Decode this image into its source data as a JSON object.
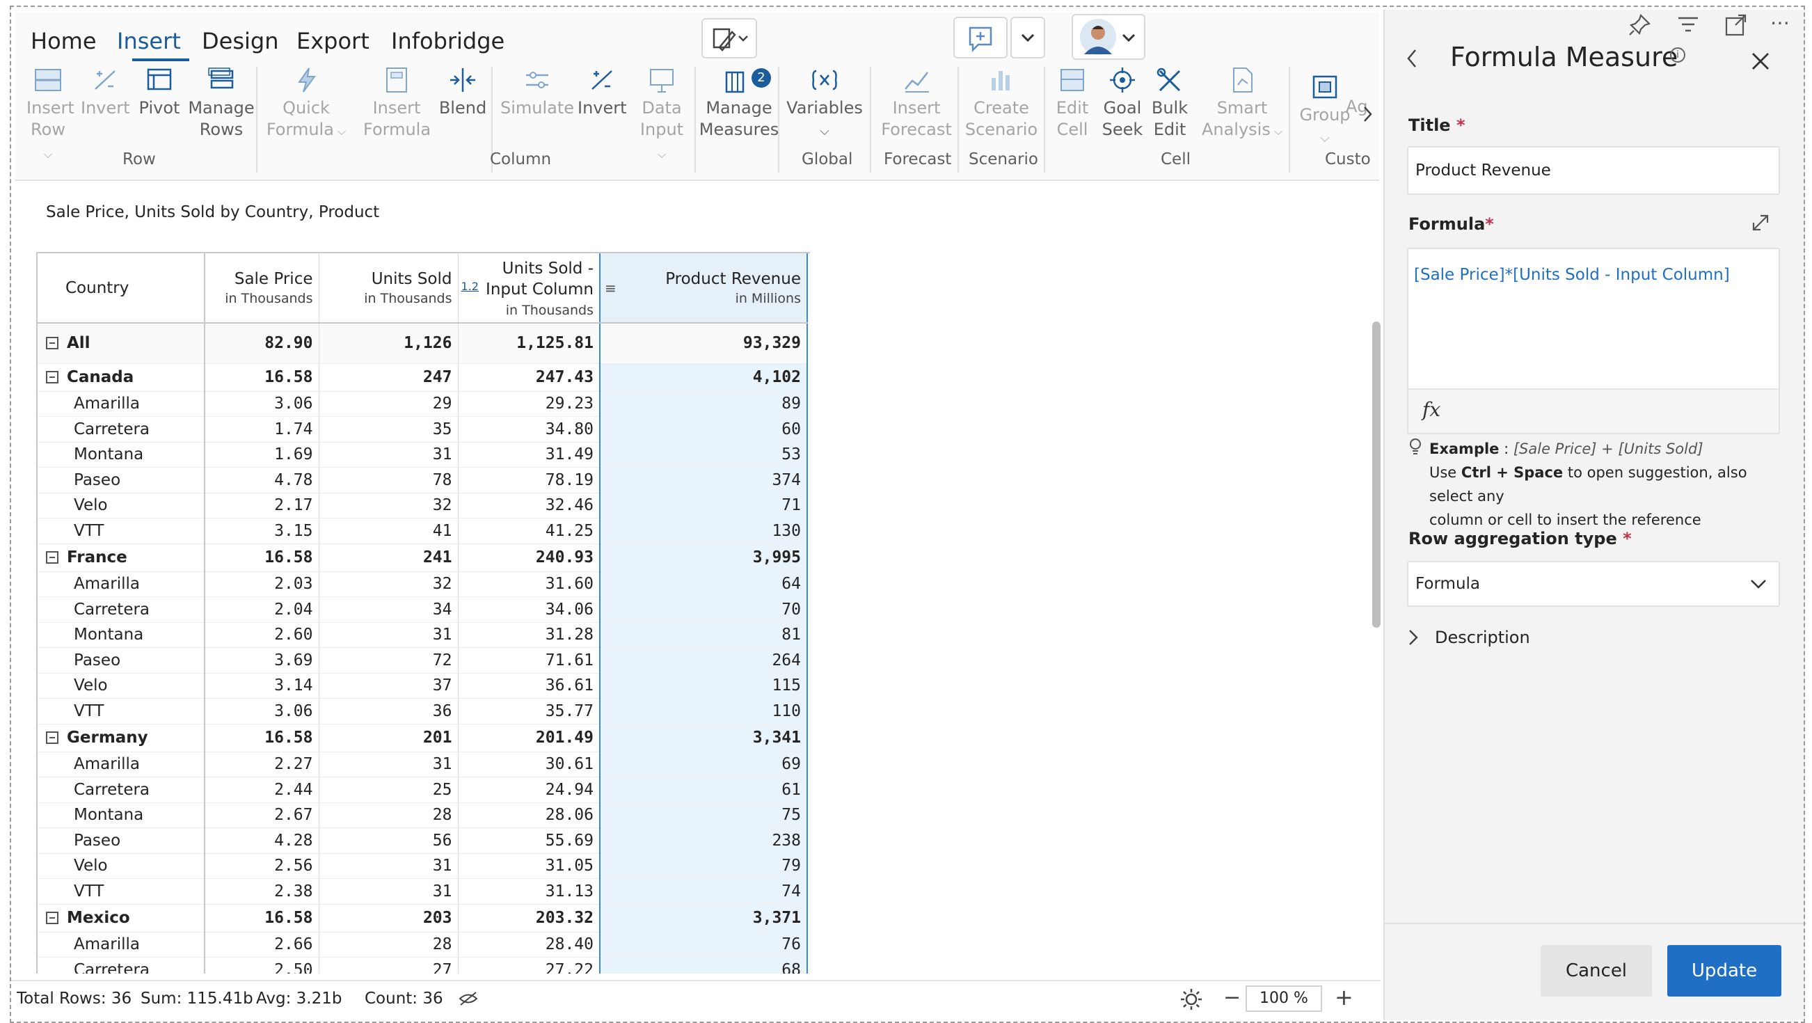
{
  "tabs": [
    {
      "label": "Home",
      "active": false
    },
    {
      "label": "Insert",
      "active": true
    },
    {
      "label": "Design",
      "active": false
    },
    {
      "label": "Export",
      "active": false
    },
    {
      "label": "Infobridge",
      "active": false
    }
  ],
  "ribbon": {
    "insert_row": [
      "Insert",
      "Row"
    ],
    "invert_row": "Invert",
    "pivot": "Pivot",
    "manage_rows": [
      "Manage",
      "Rows"
    ],
    "quick_formula": [
      "Quick",
      "Formula"
    ],
    "insert_formula": [
      "Insert",
      "Formula"
    ],
    "blend": "Blend",
    "simulate": "Simulate",
    "invert_col": "Invert",
    "data_input": [
      "Data",
      "Input"
    ],
    "manage_measures": [
      "Manage",
      "Measures"
    ],
    "measures_badge": "2",
    "variables": "Variables",
    "insert_forecast": [
      "Insert",
      "Forecast"
    ],
    "create_scenario": [
      "Create",
      "Scenario"
    ],
    "edit_cell": [
      "Edit",
      "Cell"
    ],
    "goal_seek": [
      "Goal",
      "Seek"
    ],
    "bulk_edit": [
      "Bulk",
      "Edit"
    ],
    "smart_analysis": [
      "Smart",
      "Analysis"
    ],
    "group": "Group",
    "ag": "Ag",
    "groups": {
      "row": "Row",
      "column": "Column",
      "global": "Global",
      "forecast": "Forecast",
      "scenario": "Scenario",
      "cell": "Cell",
      "custom": "Custo"
    }
  },
  "chart_title": "Sale Price, Units Sold by Country, Product",
  "table": {
    "headers": [
      {
        "label": "Country",
        "sub": ""
      },
      {
        "label": "Sale Price",
        "sub": "in Thousands"
      },
      {
        "label": "Units Sold",
        "sub": "in Thousands"
      },
      {
        "label": "Units Sold - Input Column",
        "sub": "in Thousands"
      },
      {
        "label": "Product Revenue",
        "sub": "in Millions"
      }
    ],
    "header_badge": "1.2",
    "rows": [
      {
        "type": "all",
        "cells": [
          "All",
          "82.90",
          "1,126",
          "1,125.81",
          "93,329"
        ]
      },
      {
        "type": "group",
        "cells": [
          "Canada",
          "16.58",
          "247",
          "247.43",
          "4,102"
        ]
      },
      {
        "type": "child",
        "cells": [
          "Amarilla",
          "3.06",
          "29",
          "29.23",
          "89"
        ]
      },
      {
        "type": "child",
        "cells": [
          "Carretera",
          "1.74",
          "35",
          "34.80",
          "60"
        ]
      },
      {
        "type": "child",
        "cells": [
          "Montana",
          "1.69",
          "31",
          "31.49",
          "53"
        ]
      },
      {
        "type": "child",
        "cells": [
          "Paseo",
          "4.78",
          "78",
          "78.19",
          "374"
        ]
      },
      {
        "type": "child",
        "cells": [
          "Velo",
          "2.17",
          "32",
          "32.46",
          "71"
        ]
      },
      {
        "type": "child",
        "cells": [
          "VTT",
          "3.15",
          "41",
          "41.25",
          "130"
        ]
      },
      {
        "type": "group",
        "cells": [
          "France",
          "16.58",
          "241",
          "240.93",
          "3,995"
        ]
      },
      {
        "type": "child",
        "cells": [
          "Amarilla",
          "2.03",
          "32",
          "31.60",
          "64"
        ]
      },
      {
        "type": "child",
        "cells": [
          "Carretera",
          "2.04",
          "34",
          "34.06",
          "70"
        ]
      },
      {
        "type": "child",
        "cells": [
          "Montana",
          "2.60",
          "31",
          "31.28",
          "81"
        ]
      },
      {
        "type": "child",
        "cells": [
          "Paseo",
          "3.69",
          "72",
          "71.61",
          "264"
        ]
      },
      {
        "type": "child",
        "cells": [
          "Velo",
          "3.14",
          "37",
          "36.61",
          "115"
        ]
      },
      {
        "type": "child",
        "cells": [
          "VTT",
          "3.06",
          "36",
          "35.77",
          "110"
        ]
      },
      {
        "type": "group",
        "cells": [
          "Germany",
          "16.58",
          "201",
          "201.49",
          "3,341"
        ]
      },
      {
        "type": "child",
        "cells": [
          "Amarilla",
          "2.27",
          "31",
          "30.61",
          "69"
        ]
      },
      {
        "type": "child",
        "cells": [
          "Carretera",
          "2.44",
          "25",
          "24.94",
          "61"
        ]
      },
      {
        "type": "child",
        "cells": [
          "Montana",
          "2.67",
          "28",
          "28.06",
          "75"
        ]
      },
      {
        "type": "child",
        "cells": [
          "Paseo",
          "4.28",
          "56",
          "55.69",
          "238"
        ]
      },
      {
        "type": "child",
        "cells": [
          "Velo",
          "2.56",
          "31",
          "31.05",
          "79"
        ]
      },
      {
        "type": "child",
        "cells": [
          "VTT",
          "2.38",
          "31",
          "31.13",
          "74"
        ]
      },
      {
        "type": "group",
        "cells": [
          "Mexico",
          "16.58",
          "203",
          "203.32",
          "3,371"
        ]
      },
      {
        "type": "child",
        "cells": [
          "Amarilla",
          "2.66",
          "28",
          "28.40",
          "76"
        ]
      },
      {
        "type": "child",
        "cells": [
          "Carretera",
          "2.50",
          "27",
          "27.22",
          "68"
        ]
      }
    ]
  },
  "status": {
    "total_rows": "Total Rows: 36",
    "sum": "Sum: 115.41b",
    "avg": "Avg: 3.21b",
    "count": "Count: 36",
    "zoom": "100 %"
  },
  "panel": {
    "title": "Formula Measure",
    "title_label": "Title",
    "title_value": "Product Revenue",
    "formula_label": "Formula",
    "formula_value": "[Sale Price]*[Units Sold - Input Column]",
    "fx": "fx",
    "example_label": "Example",
    "example_value": "[Sale Price] + [Units Sold]",
    "hint_use": "Use",
    "hint_keys": "Ctrl + Space",
    "hint_rest": "to open suggestion, also select any",
    "hint_line2": "column or cell to insert the reference",
    "aggregation_label": "Row aggregation type",
    "aggregation_value": "Formula",
    "description_label": "Description",
    "cancel_label": "Cancel",
    "update_label": "Update"
  },
  "colors": {
    "accent": "#1b5d9b",
    "primary_button": "#1f6fc5",
    "link_text": "#1f6fc5",
    "highlight_column": "#e9f3fb",
    "required": "#c4314b"
  }
}
